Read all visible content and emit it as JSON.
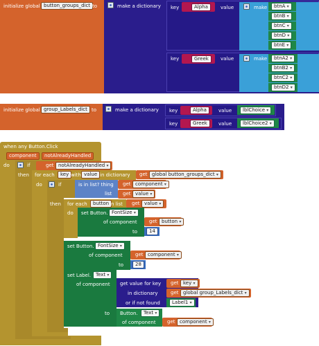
{
  "block1": {
    "prefix": "initialize global",
    "var": "button_groups_dict",
    "to": "to",
    "make_dict": "make a dictionary",
    "pair1": {
      "key_kw": "key",
      "key": "Alpha",
      "value_kw": "value",
      "make_list": "make a list",
      "items": [
        "btnA",
        "btnB",
        "btnC",
        "btnD",
        "btnE"
      ]
    },
    "pair2": {
      "key_kw": "key",
      "key": "Greek",
      "value_kw": "value",
      "make_list": "make a list",
      "items": [
        "btnA2",
        "btnB2",
        "btnC2",
        "btnD2"
      ]
    }
  },
  "block2": {
    "prefix": "initialize global",
    "var": "group_Labels_dict",
    "to": "to",
    "make_dict": "make a dictionary",
    "pair1": {
      "key_kw": "key",
      "key": "Alpha",
      "value_kw": "value",
      "value": "lblChoice"
    },
    "pair2": {
      "key_kw": "key",
      "key": "Greek",
      "value_kw": "value",
      "value": "lblChoice2"
    }
  },
  "event": {
    "title": "when any Button.Click",
    "param1": "component",
    "param2": "notAlreadyHandled",
    "do": "do",
    "if": "if",
    "get": "get",
    "cond_var": "notAlreadyHandled",
    "then": "then",
    "for_each": "for each",
    "key_var": "key",
    "with": "with",
    "value_var": "value",
    "in_dictionary": "in dictionary",
    "dict_ref": "global button_groups_dict",
    "do2": "do",
    "if2": "if",
    "is_in_list": "is in list? thing",
    "list": "list",
    "then2": "then",
    "for_each_item": "for each",
    "button_var": "button",
    "in_list": "in list",
    "do3": "do",
    "set_button": "set Button.",
    "fontsize_prop": "FontSize",
    "of_component": "of component",
    "to_kw": "to",
    "num14": "14",
    "num28": "28",
    "set_label": "set Label.",
    "text_prop": "Text",
    "get_value_for_key": "get value for key",
    "in_dictionary2": "in dictionary",
    "labels_ref": "global group_Labels_dict",
    "or_if_not_found": "or if not found",
    "label1": "Label1",
    "button_text": "Button.",
    "text_prop2": "Text",
    "of_component2": "of component"
  }
}
